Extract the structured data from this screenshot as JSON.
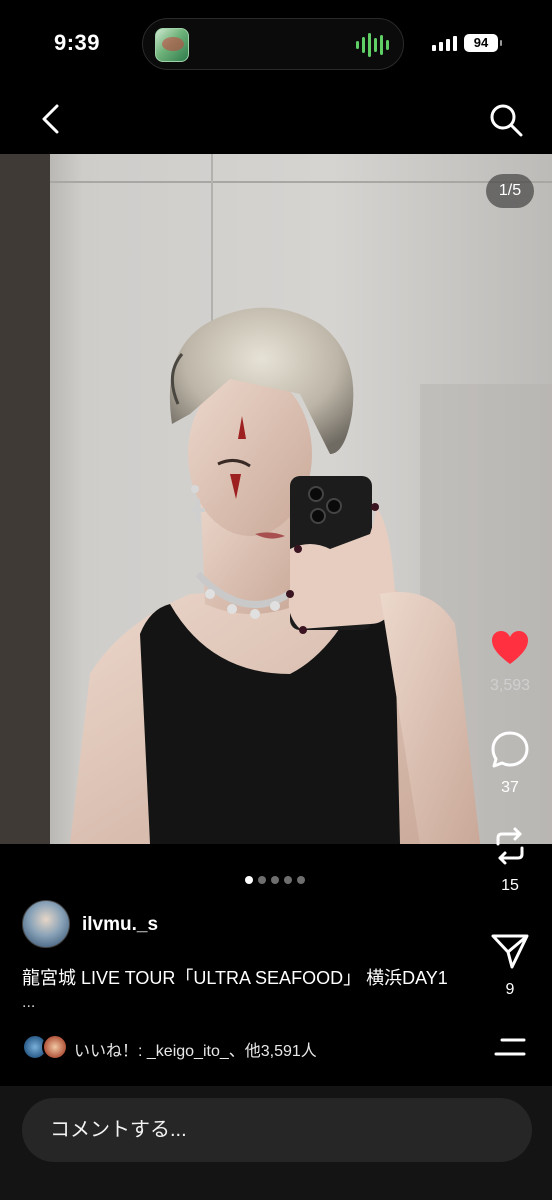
{
  "status_bar": {
    "time": "9:39",
    "battery": "94",
    "app_icon": "nichijou-app-icon",
    "audio_indicator": "audio-wave-icon"
  },
  "nav": {
    "back_icon": "chevron-left-icon",
    "search_icon": "search-icon"
  },
  "post": {
    "image_counter": "1/5",
    "image_count": 5,
    "current_image": 1,
    "username": "ilvmu._s",
    "caption": "龍宮城 LIVE TOUR「ULTRA SEAFOOD」 横浜DAY1",
    "caption_more": "...",
    "likes_text": "いいね！: _keigo_ito_、他3,591人"
  },
  "actions": {
    "like_count": "3,593",
    "comment_count": "37",
    "repost_count": "15",
    "share_count": "9",
    "like_color": "#ff3040"
  },
  "comment": {
    "placeholder": "コメントする..."
  }
}
